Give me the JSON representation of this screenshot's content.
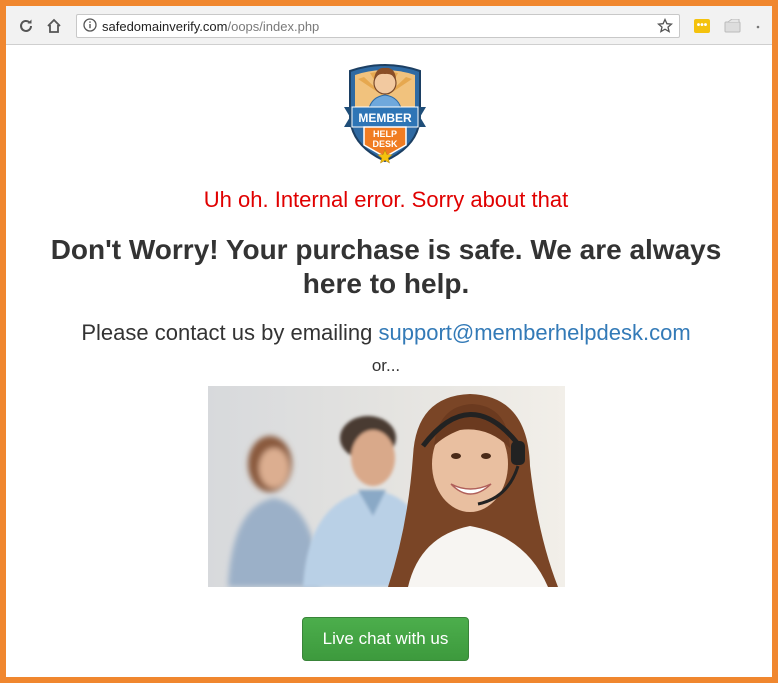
{
  "browser": {
    "url_domain": "safedomainverify.com",
    "url_path": "/oops/index.php",
    "icons": [
      "reload-icon",
      "home-icon",
      "info-icon",
      "bookmark-star-icon",
      "extension-icon",
      "cast-icon"
    ]
  },
  "page": {
    "logo": {
      "line1": "MEMBER",
      "line2": "HELP",
      "line3": "DESK"
    },
    "error_text": "Uh oh. Internal error. Sorry about that",
    "headline": "Don't Worry! Your purchase is safe. We are always here to help.",
    "contact_prefix": "Please contact us by emailing ",
    "contact_email": "support@memberhelpdesk.com",
    "or_text": "or...",
    "chat_button": "Live chat with us"
  },
  "colors": {
    "frame": "#f0872f",
    "error": "#e00000",
    "link": "#337ab7",
    "button": "#449d44"
  }
}
